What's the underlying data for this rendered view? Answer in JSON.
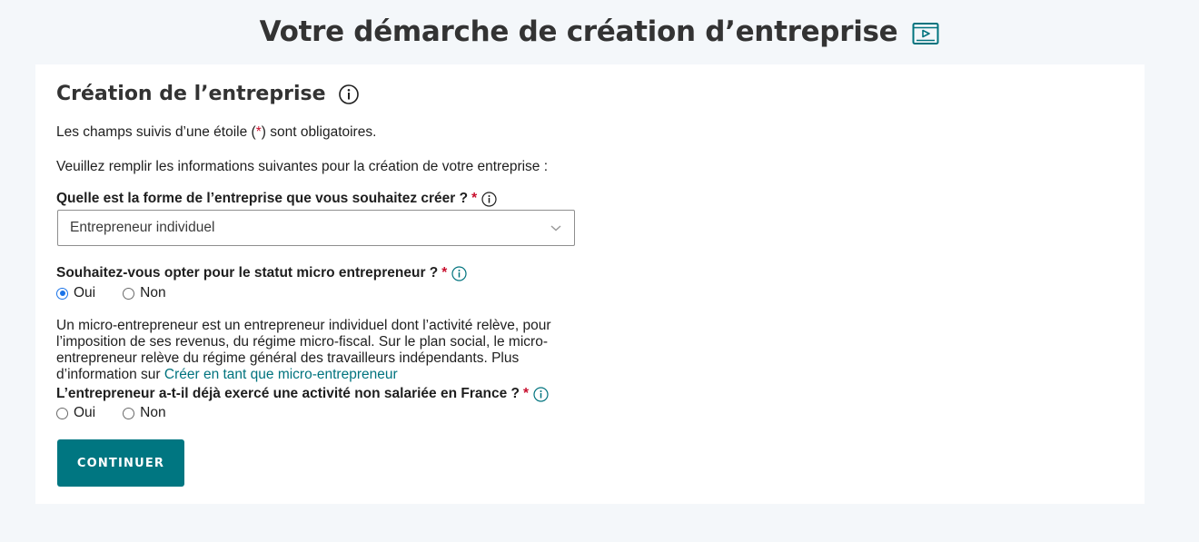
{
  "header": {
    "title": "Votre démarche de création d’entreprise",
    "video_icon": "video-play-icon"
  },
  "section": {
    "title": "Création de l’entreprise",
    "info_icon": "info-icon"
  },
  "intro": {
    "required_prefix": "Les champs suivis d’une étoile (",
    "required_star": "*",
    "required_suffix": ") sont obligatoires.",
    "instruction": "Veuillez remplir les informations suivantes pour la création de votre entreprise :"
  },
  "q_forme": {
    "label": "Quelle est la forme de l’entreprise que vous souhaitez créer ?",
    "star": "*",
    "selected": "Entrepreneur individuel"
  },
  "q_micro": {
    "label": "Souhaitez-vous opter pour le statut micro entrepreneur ?",
    "star": "*",
    "options": [
      "Oui",
      "Non"
    ],
    "selected": "Oui"
  },
  "micro_info": {
    "text": "Un micro-entrepreneur est un entrepreneur individuel dont l’activité relève, pour l’imposition de ses revenus, du régime micro-fiscal. Sur le plan social, le micro-entrepreneur relève du régime général des travailleurs indépendants. Plus d’information sur ",
    "link": "Créer en tant que micro-entrepreneur"
  },
  "q_exerce": {
    "label": "L’entrepreneur a-t-il déjà exercé une activité non salariée en France ?",
    "star": "*",
    "options": [
      "Oui",
      "Non"
    ],
    "selected": null
  },
  "actions": {
    "continue_label": "CONTINUER"
  },
  "colors": {
    "accent": "#007681",
    "link": "#00737e",
    "required": "#c8102e",
    "radio_checked": "#1a73e8",
    "background": "#f4f7fa"
  }
}
